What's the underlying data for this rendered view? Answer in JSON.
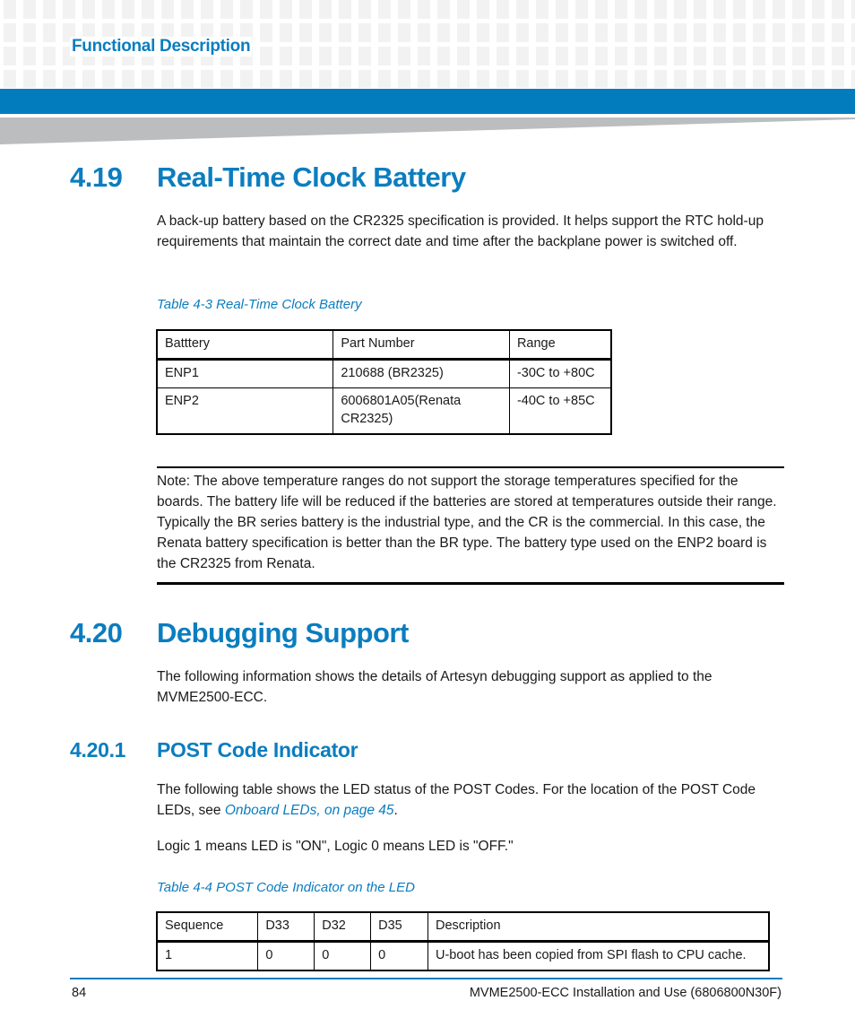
{
  "header": {
    "chapter_title": "Functional Description"
  },
  "section_419": {
    "number": "4.19",
    "title": "Real-Time Clock Battery",
    "body": "A back-up battery based on the CR2325 specification is provided. It helps support the RTC hold-up requirements that maintain the correct date and time after the backplane power is switched off.",
    "table_caption": "Table 4-3 Real-Time Clock Battery",
    "table": {
      "headers": [
        "Batttery",
        "Part Number",
        "Range"
      ],
      "rows": [
        [
          "ENP1",
          "210688 (BR2325)",
          "-30C to +80C"
        ],
        [
          "ENP2",
          "6006801A05(Renata CR2325)",
          "-40C to +85C"
        ]
      ]
    },
    "note": "Note:  The above temperature ranges do not support the storage temperatures specified for the boards. The battery life will be reduced if the batteries are stored at temperatures outside their range. Typically the BR series battery is the industrial type, and the CR is the commercial. In this case, the Renata battery specification is better than the BR type. The battery type used on the ENP2 board is the CR2325 from Renata."
  },
  "section_420": {
    "number": "4.20",
    "title": "Debugging Support",
    "body": "The following information shows the details of Artesyn debugging support as applied to the MVME2500-ECC."
  },
  "section_4201": {
    "number": "4.20.1",
    "title": "POST Code Indicator",
    "body_prefix": "The following table shows the LED status of the POST Codes.  For the location of the POST Code LEDs, see ",
    "body_link": "Onboard LEDs, on page 45",
    "body_suffix": ".",
    "logic_note": "Logic 1 means LED is \"ON\", Logic 0 means LED is \"OFF.\"",
    "table_caption": "Table 4-4 POST Code Indicator on the LED",
    "table": {
      "headers": [
        "Sequence",
        "D33",
        "D32",
        "D35",
        "Description"
      ],
      "rows": [
        [
          "1",
          "0",
          "0",
          "0",
          "U-boot has been copied from SPI flash to CPU cache."
        ]
      ]
    }
  },
  "footer": {
    "page_number": "84",
    "document_title": "MVME2500-ECC Installation and Use (6806800N30F)"
  }
}
